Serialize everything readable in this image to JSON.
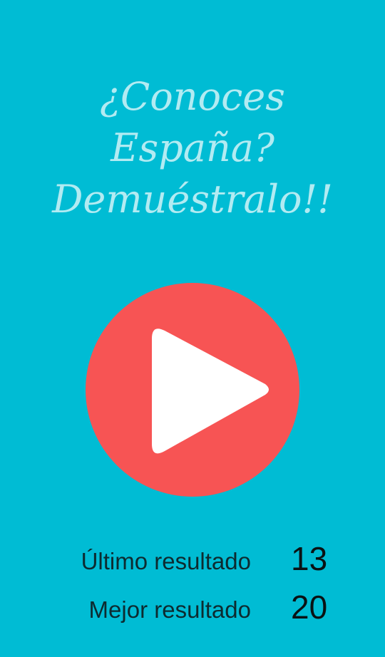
{
  "title": {
    "line1": "¿Conoces",
    "line2": "España?",
    "line3": "Demuéstralo!!"
  },
  "play_button": {
    "icon": "play-icon",
    "color": "#f75454"
  },
  "stats": {
    "last_label": "Último resultado",
    "last_value": "13",
    "best_label": "Mejor resultado",
    "best_value": "20"
  },
  "colors": {
    "background": "#00bcd4",
    "title": "#b2ebf2",
    "play_circle": "#f75454",
    "play_triangle": "#ffffff"
  }
}
